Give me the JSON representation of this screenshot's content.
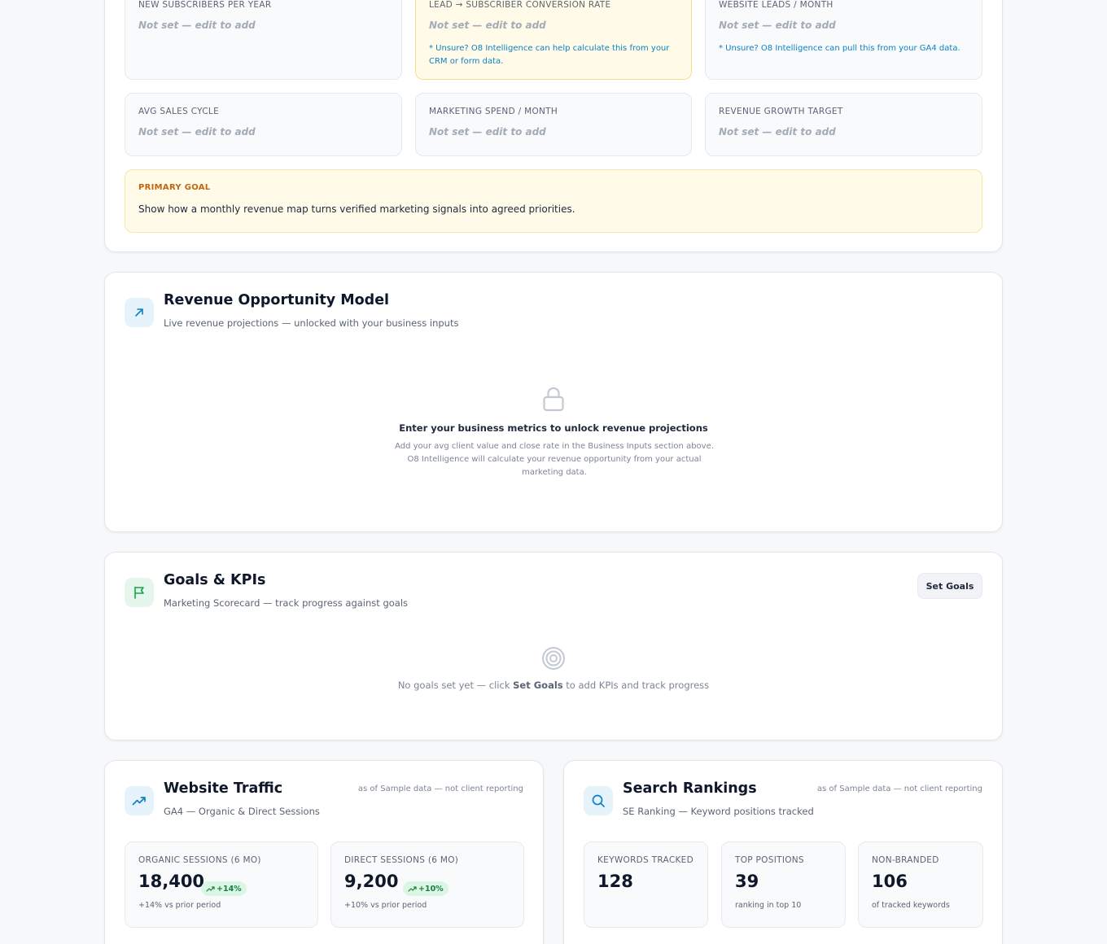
{
  "business_inputs": {
    "metrics": [
      {
        "label": "NEW SUBSCRIBERS PER YEAR",
        "value": "Not set — edit to add"
      },
      {
        "label": "LEAD → SUBSCRIBER CONVERSION RATE",
        "value": "Not set — edit to add",
        "hint": "* Unsure? O8 Intelligence can help calculate this from your CRM or form data."
      },
      {
        "label": "WEBSITE LEADS / MONTH",
        "value": "Not set — edit to add",
        "hint": "* Unsure? O8 Intelligence can pull this from your GA4 data."
      },
      {
        "label": "AVG SALES CYCLE",
        "value": "Not set — edit to add"
      },
      {
        "label": "MARKETING SPEND / MONTH",
        "value": "Not set — edit to add"
      },
      {
        "label": "REVENUE GROWTH TARGET",
        "value": "Not set — edit to add"
      }
    ],
    "primary_goal": {
      "label": "PRIMARY GOAL",
      "text": "Show how a monthly revenue map turns verified marketing signals into agreed priorities."
    }
  },
  "revenue_model": {
    "icon": "arrow-up-right-icon",
    "title": "Revenue Opportunity Model",
    "subtitle": "Live revenue projections — unlocked with your business inputs",
    "empty_icon": "lock-icon",
    "empty_title": "Enter your business metrics to unlock revenue projections",
    "empty_description": "Add your avg client value and close rate in the Business Inputs section above. O8 Intelligence will calculate your revenue opportunity from your actual marketing data."
  },
  "goals": {
    "icon": "flag-icon",
    "title": "Goals & KPIs",
    "subtitle": "Marketing Scorecard — track progress against goals",
    "set_goals_label": "Set Goals",
    "empty_icon": "target-icon",
    "empty_prefix": "No goals set yet — click ",
    "empty_strong": "Set Goals",
    "empty_suffix": " to add KPIs and track progress"
  },
  "website_traffic": {
    "icon": "trending-up-icon",
    "title": "Website Traffic",
    "subtitle": "GA4 — Organic & Direct Sessions",
    "as_of": "as of Sample data — not client reporting",
    "stats": [
      {
        "label": "ORGANIC SESSIONS (6 MO)",
        "value": "18,400",
        "badge": "+14%",
        "note": "+14% vs prior period"
      },
      {
        "label": "DIRECT SESSIONS (6 MO)",
        "value": "9,200",
        "badge": "+10%",
        "note": "+10% vs prior period"
      }
    ]
  },
  "search_rankings": {
    "icon": "search-icon",
    "title": "Search Rankings",
    "subtitle": "SE Ranking — Keyword positions tracked",
    "as_of": "as of Sample data — not client reporting",
    "stats": [
      {
        "label": "KEYWORDS TRACKED",
        "value": "128",
        "note": ""
      },
      {
        "label": "TOP POSITIONS",
        "value": "39",
        "note": "ranking in top 10"
      },
      {
        "label": "NON-BRANDED",
        "value": "106",
        "note": "of tracked keywords"
      }
    ]
  },
  "colors": {
    "accent_blue": "#0b82c4",
    "accent_green": "#16a34a",
    "highlight_bg": "#fffbe8",
    "goal_label": "#c0660e"
  }
}
